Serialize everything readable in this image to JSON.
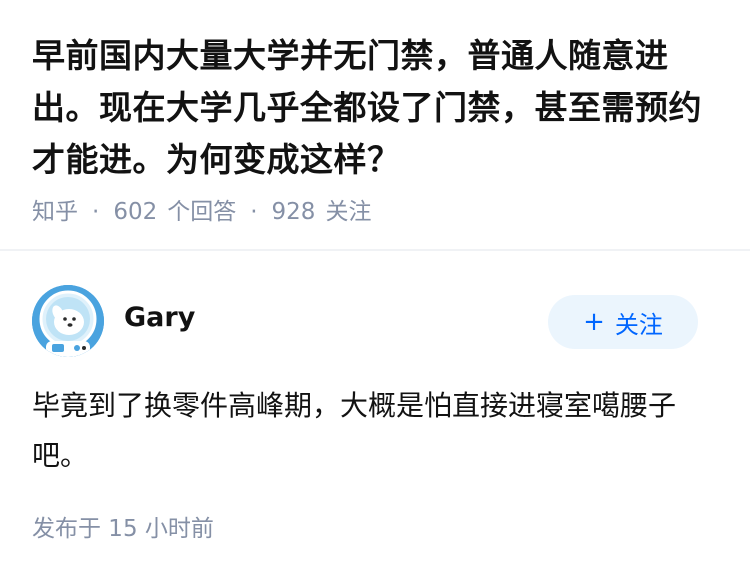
{
  "question": {
    "title": "早前国内大量大学并无门禁，普通人随意进出。现在大学几乎全都设了门禁，甚至需预约才能进。为何变成这样？",
    "site": "知乎",
    "answer_count": "602",
    "answer_label": "个回答",
    "follower_count": "928",
    "follower_label": "关注"
  },
  "answer": {
    "author": "Gary",
    "avatar_icon": "astronaut-dog-avatar-icon",
    "follow_label": "关注",
    "follow_icon": "plus-icon",
    "content": "毕竟到了换零件高峰期，大概是怕直接进寝室噶腰子吧。",
    "time": "发布于  15 小时前"
  },
  "colors": {
    "text": "#121212",
    "meta": "#8590a6",
    "accent": "#0066ff",
    "follow_bg": "#ebf5fd",
    "avatar_bg": "#4aa3df"
  }
}
